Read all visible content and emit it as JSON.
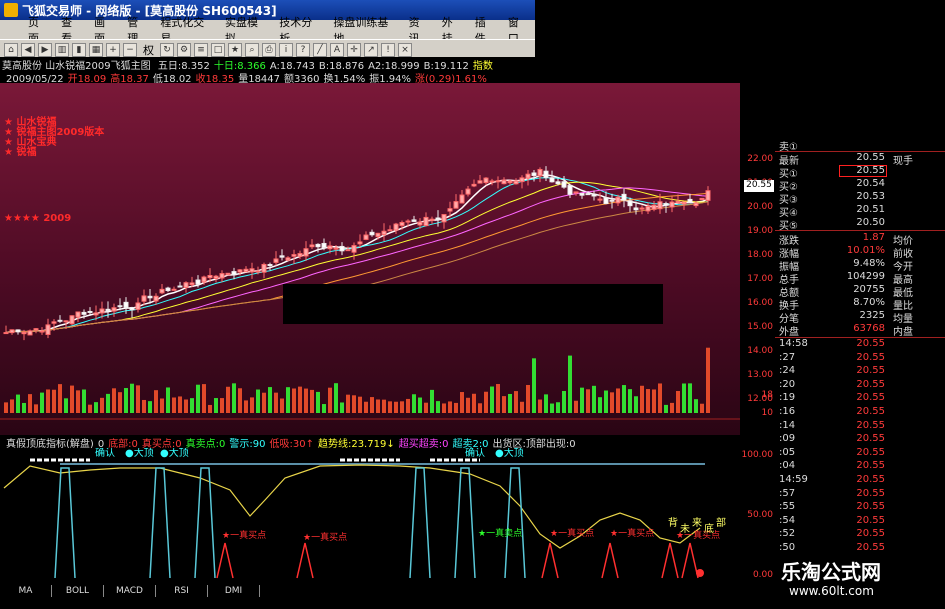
{
  "window": {
    "title": "飞狐交易师 - 网络版 - [莫高股份 SH600543]"
  },
  "menu": [
    "页面",
    "查看",
    "画面",
    "管理",
    "程式化交易",
    "实盘模拟",
    "技术分析",
    "操盘训练基地",
    "资讯",
    "外挂",
    "插件",
    "窗口"
  ],
  "toolbar": {
    "quan_label": "权"
  },
  "strip1": {
    "stock": "莫高股份",
    "template": "山水锐福2009飞狐主图",
    "items": [
      {
        "text": "五日:8.352",
        "color": "white"
      },
      {
        "text": "十日:8.366",
        "color": "green"
      },
      {
        "text": "A:18.743",
        "color": "white"
      },
      {
        "text": "B:18.876",
        "color": "white"
      },
      {
        "text": "A2:18.999",
        "color": "white"
      },
      {
        "text": "B:19.112",
        "color": "white"
      },
      {
        "text": "指数",
        "color": "yellow"
      }
    ]
  },
  "strip2": {
    "items": [
      {
        "text": "2009/05/22",
        "color": "white"
      },
      {
        "text": "开18.09",
        "color": "red"
      },
      {
        "text": "高18.37",
        "color": "red"
      },
      {
        "text": "低18.02",
        "color": "white"
      },
      {
        "text": "收18.35",
        "color": "red"
      },
      {
        "text": "量18447",
        "color": "white"
      },
      {
        "text": "额3360",
        "color": "white"
      },
      {
        "text": "换1.54%",
        "color": "white"
      },
      {
        "text": "振1.94%",
        "color": "white"
      },
      {
        "text": "涨(0.29)1.61%",
        "color": "red"
      }
    ]
  },
  "legend_lines": [
    "山水锐福",
    "锐福主图2009版本",
    "山水宝典",
    "锐福",
    "山",
    "水",
    "锐",
    "福",
    "主",
    "图",
    "★★★★ 2009"
  ],
  "price_axis": [
    "22.00",
    "21.00",
    "20.00",
    "19.00",
    "18.00",
    "17.00",
    "16.00",
    "15.00",
    "14.00",
    "13.00",
    "12.00"
  ],
  "volume_axis": [
    "18",
    "10"
  ],
  "current_price": "20.55",
  "quote": {
    "sell_label": "卖①",
    "latest": {
      "label": "最新",
      "value": "20.55",
      "right": "现手"
    },
    "buys": [
      {
        "label": "买①",
        "value": "20.55"
      },
      {
        "label": "买②",
        "value": "20.54"
      },
      {
        "label": "买③",
        "value": "20.53"
      },
      {
        "label": "买④",
        "value": "20.51"
      },
      {
        "label": "买⑤",
        "value": "20.50"
      }
    ],
    "stats": [
      {
        "label": "涨跌",
        "value": "1.87",
        "right": "均价",
        "color": "red"
      },
      {
        "label": "涨幅",
        "value": "10.01%",
        "right": "前收",
        "color": "red"
      },
      {
        "label": "振幅",
        "value": "9.48%",
        "right": "今开",
        "color": "white"
      },
      {
        "label": "总手",
        "value": "104299",
        "right": "最高",
        "color": "white"
      },
      {
        "label": "总额",
        "value": "20755",
        "right": "最低",
        "color": "white"
      },
      {
        "label": "换手",
        "value": "8.70%",
        "right": "量比",
        "color": "white"
      },
      {
        "label": "分笔",
        "value": "2325",
        "right": "均量",
        "color": "white"
      },
      {
        "label": "外盘",
        "value": "63768",
        "right": "内盘",
        "color": "red"
      }
    ],
    "ticks": [
      {
        "time": "14:58",
        "price": "20.55"
      },
      {
        "time": ":27",
        "price": "20.55"
      },
      {
        "time": ":24",
        "price": "20.55"
      },
      {
        "time": ":20",
        "price": "20.55"
      },
      {
        "time": ":19",
        "price": "20.55"
      },
      {
        "time": ":16",
        "price": "20.55"
      },
      {
        "time": ":14",
        "price": "20.55"
      },
      {
        "time": ":09",
        "price": "20.55"
      },
      {
        "time": ":05",
        "price": "20.55"
      },
      {
        "time": ":04",
        "price": "20.55"
      },
      {
        "time": "14:59",
        "price": "20.55"
      },
      {
        "time": ":57",
        "price": "20.55"
      },
      {
        "time": ":55",
        "price": "20.55"
      },
      {
        "time": ":54",
        "price": "20.55"
      },
      {
        "time": ":52",
        "price": "20.55"
      },
      {
        "time": ":50",
        "price": "20.55"
      },
      {
        "time": ":48",
        "price": "20.55"
      },
      {
        "time": ":46",
        "price": "20.55"
      }
    ]
  },
  "indicator": {
    "header": [
      {
        "text": "真假顶底指标(解盘)",
        "color": "white"
      },
      {
        "text": "0",
        "color": "white"
      },
      {
        "text": "底部:0",
        "color": "red"
      },
      {
        "text": "真买点:0",
        "color": "red"
      },
      {
        "text": "真卖点:0",
        "color": "green"
      },
      {
        "text": "警示:90",
        "color": "cyan"
      },
      {
        "text": "低吸:30↑",
        "color": "red"
      },
      {
        "text": "趋势线:23.719↓",
        "color": "yellow"
      },
      {
        "text": "超买超卖:0",
        "color": "mag"
      },
      {
        "text": "超卖2:0",
        "color": "cyan"
      },
      {
        "text": "出货区:顶部出现:0",
        "color": "white"
      }
    ],
    "axis": [
      "100.00",
      "50.00",
      "0.00"
    ],
    "labels_confirm": [
      "确认",
      "大顶",
      "确认",
      "大顶",
      "确认",
      "大顶"
    ],
    "buy_points": [
      "真买点",
      "真买点",
      "真卖点",
      "真买点",
      "真买点",
      "真买点",
      "真买点"
    ],
    "vertical_text": [
      "背",
      "未",
      "来",
      "底",
      "部"
    ]
  },
  "tabs": [
    "MA",
    "BOLL",
    "MACD",
    "RSI",
    "DMI"
  ],
  "watermark": {
    "title": "乐淘公式网",
    "url": "www.60lt.com"
  }
}
